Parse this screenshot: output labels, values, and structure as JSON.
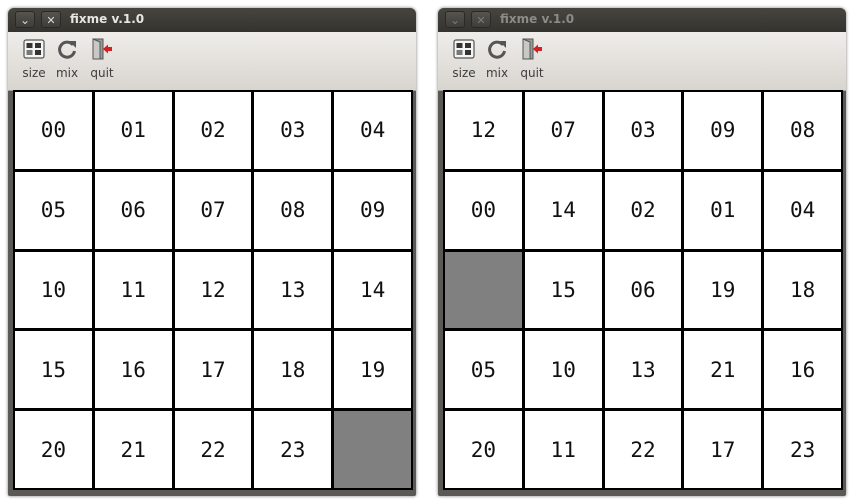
{
  "windows": [
    {
      "title": "fixme v.1.0",
      "active": true,
      "toolbar": [
        {
          "icon": "resize-icon",
          "label": "size"
        },
        {
          "icon": "refresh-icon",
          "label": "mix"
        },
        {
          "icon": "exit-icon",
          "label": "quit"
        }
      ],
      "tiles": [
        "00",
        "01",
        "02",
        "03",
        "04",
        "05",
        "06",
        "07",
        "08",
        "09",
        "10",
        "11",
        "12",
        "13",
        "14",
        "15",
        "16",
        "17",
        "18",
        "19",
        "20",
        "21",
        "22",
        "23",
        ""
      ]
    },
    {
      "title": "fixme v.1.0",
      "active": false,
      "toolbar": [
        {
          "icon": "resize-icon",
          "label": "size"
        },
        {
          "icon": "refresh-icon",
          "label": "mix"
        },
        {
          "icon": "exit-icon",
          "label": "quit"
        }
      ],
      "tiles": [
        "12",
        "07",
        "03",
        "09",
        "08",
        "00",
        "14",
        "02",
        "01",
        "04",
        "",
        "15",
        "06",
        "19",
        "18",
        "05",
        "10",
        "13",
        "21",
        "16",
        "20",
        "11",
        "22",
        "17",
        "23"
      ]
    }
  ],
  "colors": {
    "blank_tile": "#808080",
    "tile": "#ffffff",
    "grid": "#000000"
  }
}
